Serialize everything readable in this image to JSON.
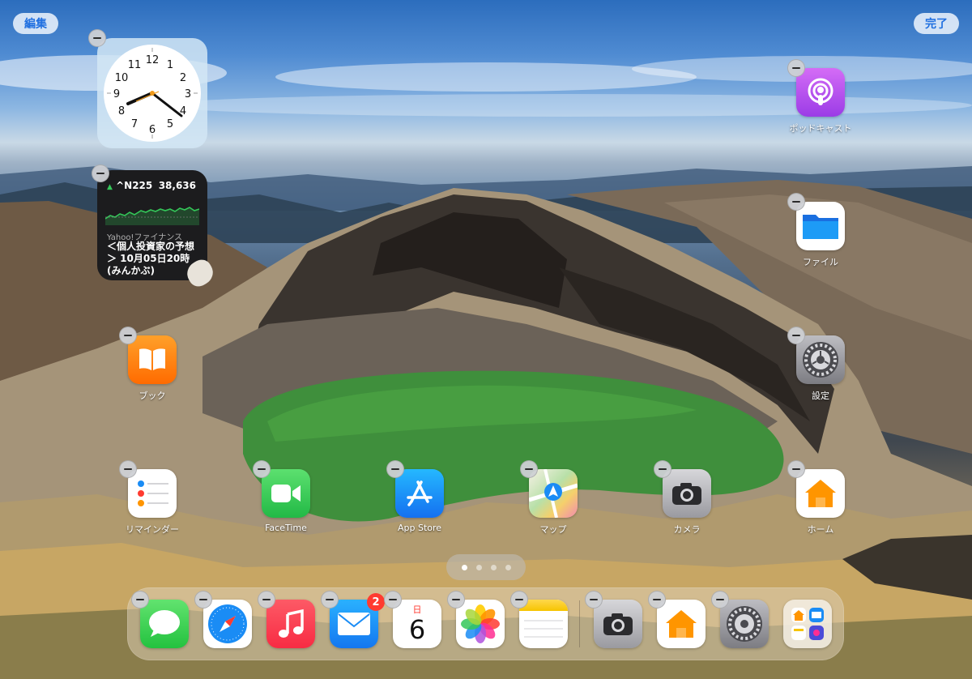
{
  "top_bar": {
    "edit_label": "編集",
    "done_label": "完了"
  },
  "widgets": {
    "clock": {
      "numbers": [
        "12",
        "1",
        "2",
        "3",
        "4",
        "5",
        "6",
        "7",
        "8",
        "9",
        "10",
        "11"
      ]
    },
    "stocks": {
      "symbol": "^N225",
      "value": "38,636",
      "source": "Yahoo!ファイナンス",
      "news": "＜個人投資家の予想＞ 10月05日20時 (みんかぶ)"
    }
  },
  "apps": [
    {
      "id": "podcasts",
      "label": "ポッドキャスト",
      "icon": "podcasts-icon",
      "color": "#b451f0"
    },
    {
      "id": "files",
      "label": "ファイル",
      "icon": "folder-icon",
      "color": "#1a8bf0"
    },
    {
      "id": "books",
      "label": "ブック",
      "icon": "book-icon",
      "color": "#ff8a00"
    },
    {
      "id": "settings",
      "label": "設定",
      "icon": "gear-icon",
      "color": "#8e8e93"
    },
    {
      "id": "reminders",
      "label": "リマインダー",
      "icon": "list-icon",
      "color": "#ffffff"
    },
    {
      "id": "facetime",
      "label": "FaceTime",
      "icon": "video-camera-icon",
      "color": "#34c759"
    },
    {
      "id": "appstore",
      "label": "App Store",
      "icon": "app-store-icon",
      "color": "#1a8cf5"
    },
    {
      "id": "maps",
      "label": "マップ",
      "icon": "map-icon",
      "color": "#6cc56c"
    },
    {
      "id": "camera",
      "label": "カメラ",
      "icon": "camera-icon",
      "color": "#8e8e93"
    },
    {
      "id": "home",
      "label": "ホーム",
      "icon": "house-icon",
      "color": "#ff9500"
    }
  ],
  "page_indicator": {
    "pages": 4,
    "current": 1
  },
  "dock": {
    "items": [
      {
        "id": "messages",
        "icon": "message-bubble-icon",
        "color": "#34c759"
      },
      {
        "id": "safari",
        "icon": "compass-icon",
        "color": "#1a8cf5"
      },
      {
        "id": "music",
        "icon": "music-note-icon",
        "color": "#fc3c44"
      },
      {
        "id": "mail",
        "icon": "envelope-icon",
        "color": "#1a8cf5",
        "badge": "2"
      },
      {
        "id": "calendar",
        "icon": "calendar-icon",
        "color": "#ffffff",
        "weekday": "日",
        "day": "6"
      },
      {
        "id": "photos",
        "icon": "photos-flower-icon",
        "color": "#ffffff"
      },
      {
        "id": "notes",
        "icon": "notes-icon",
        "color": "#ffffff"
      },
      {
        "id": "camera",
        "icon": "camera-icon",
        "color": "#8e8e93"
      },
      {
        "id": "home",
        "icon": "house-icon",
        "color": "#ffffff"
      },
      {
        "id": "settings",
        "icon": "gear-icon",
        "color": "#8e8e93"
      },
      {
        "id": "app-library",
        "icon": "app-library-icon",
        "color": "#ffffff"
      }
    ]
  }
}
